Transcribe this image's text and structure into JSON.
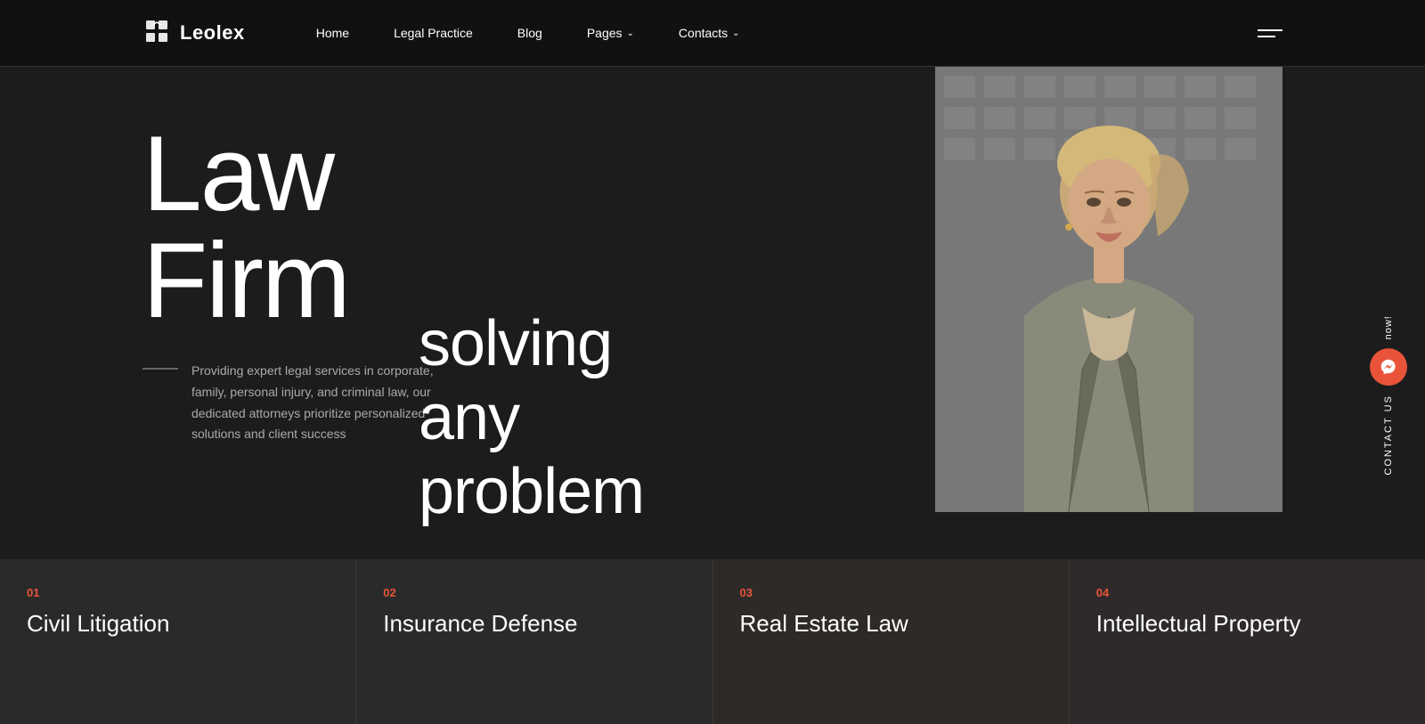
{
  "brand": {
    "logo_text_light": "Leo",
    "logo_text_bold": "lex"
  },
  "nav": {
    "links": [
      {
        "label": "Home",
        "has_dropdown": false
      },
      {
        "label": "Legal Practice",
        "has_dropdown": false
      },
      {
        "label": "Blog",
        "has_dropdown": false
      },
      {
        "label": "Pages",
        "has_dropdown": true
      },
      {
        "label": "Contacts",
        "has_dropdown": true
      }
    ]
  },
  "hero": {
    "title_line1": "Law",
    "title_line2": "Firm",
    "tagline_line1": "solving",
    "tagline_line2": "any",
    "tagline_line3": "problem",
    "description": "Providing expert legal services in corporate, family, personal injury, and criminal law, our dedicated attorneys prioritize personalized solutions and client success"
  },
  "contact_sidebar": {
    "now_label": "now!",
    "contact_label": "Contact us"
  },
  "cards": [
    {
      "number": "01",
      "title": "Civil Litigation"
    },
    {
      "number": "02",
      "title": "Insurance Defense"
    },
    {
      "number": "03",
      "title": "Real Estate Law"
    },
    {
      "number": "04",
      "title": "Intellectual Property"
    }
  ],
  "colors": {
    "accent": "#e8533a",
    "bg_dark": "#111111",
    "bg_main": "#1c1c1c",
    "card_bg": "#2a2a2a"
  }
}
